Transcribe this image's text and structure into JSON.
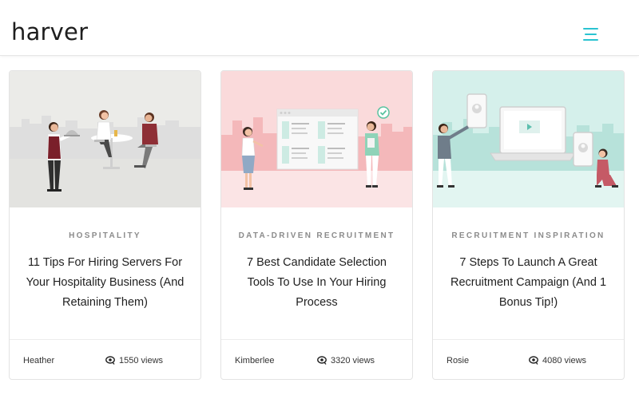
{
  "header": {
    "logo": "harver",
    "menu_icon": "hamburger-menu-icon",
    "accent_color": "#2ac3d1"
  },
  "cards": [
    {
      "category": "HOSPITALITY",
      "title": "11 Tips For Hiring Servers For Your Hospitality Business (And Retaining Them)",
      "author": "Heather",
      "views": "1550 views",
      "image_background": "#ebebe8"
    },
    {
      "category": "DATA-DRIVEN RECRUITMENT",
      "title": "7 Best Candidate Selection Tools To Use In Your Hiring Process",
      "author": "Kimberlee",
      "views": "3320 views",
      "image_background": "#fadadb"
    },
    {
      "category": "RECRUITMENT INSPIRATION",
      "title": "7 Steps To Launch A Great Recruitment Campaign (And 1 Bonus Tip!)",
      "author": "Rosie",
      "views": "4080 views",
      "image_background": "#d5f0eb"
    }
  ]
}
